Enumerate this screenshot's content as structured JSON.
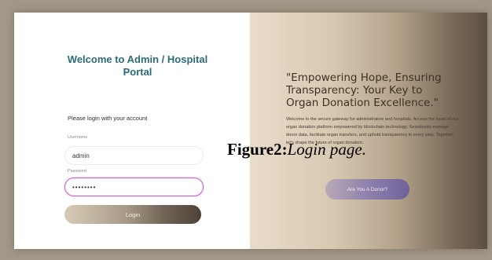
{
  "login_panel": {
    "title": "Welcome to Admin / Hospital Portal",
    "prompt": "Please login with your account",
    "username_label": "Username",
    "username_value": "admin",
    "password_label": "Password",
    "password_value": "••••••••",
    "login_button": "Login"
  },
  "promo_panel": {
    "headline": "\"Empowering Hope, Ensuring Transparency: Your Key to Organ Donation Excellence.\"",
    "description": "Welcome to the secure gateway for administrators and hospitals. Access the heart of our organ donation platform empowered by blockchain technology. Seamlessly manage donor data, facilitate organ transfers, and uphold transparency in every step. Together, let's shape the future of organ donation.",
    "donor_button": "Are You A Donor?"
  },
  "caption": {
    "label": "Figure2:",
    "text": "Login page."
  },
  "colors": {
    "title_teal": "#2b6b78",
    "password_focus": "#c75fc9",
    "donor_button": "#8b7dab",
    "dark_brown": "#5b4e42"
  }
}
